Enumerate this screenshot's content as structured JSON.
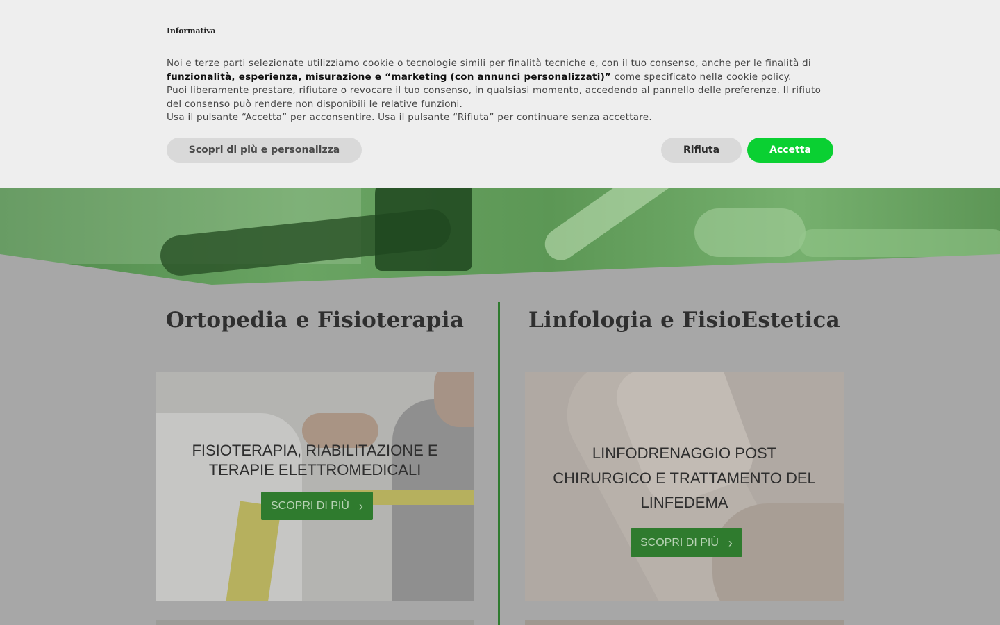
{
  "banner": {
    "title": "Informativa",
    "para1_a": "Noi e terze parti selezionate utilizziamo cookie o tecnologie simili per finalità tecniche e, con il tuo consenso, anche per le finalità di",
    "para1_bold": "funzionalità, esperienza, misurazione e “marketing (con annunci personalizzati)”",
    "para1_b": " come specificato nella ",
    "para1_link": "cookie policy",
    "para1_end": ".",
    "para2": "Puoi liberamente prestare, rifiutare o revocare il tuo consenso, in qualsiasi momento, accedendo al pannello delle preferenze. Il rifiuto del consenso può rendere non disponibili le relative funzioni.",
    "para3": "Usa il pulsante “Accetta” per acconsentire. Usa il pulsante “Rifiuta” per continuare senza accettare.",
    "btn_more": "Scopri di più e personalizza",
    "btn_reject": "Rifiuta",
    "btn_accept": "Accetta"
  },
  "columns": [
    {
      "title": "Ortopedia e Fisioterapia",
      "card_text": "FISIOTERAPIA, RIABILITAZIONE E TERAPIE ELETTROMEDICALI",
      "card_button": "SCOPRI DI PIÙ"
    },
    {
      "title": "Linfologia e FisioEstetica",
      "card_text": "LINFODRENAGGIO POST CHIRURGICO E TRATTAMENTO DEL LINFEDEMA",
      "card_button": "SCOPRI DI PIÙ"
    }
  ],
  "icons": {
    "chevron": "chevron-right-icon"
  },
  "colors": {
    "accent_green": "#2f7b2e",
    "accept_green": "#0ad032",
    "banner_bg": "#eeeeee"
  }
}
